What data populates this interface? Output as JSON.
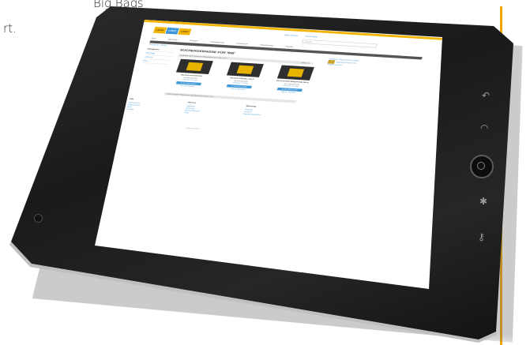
{
  "page_text": {
    "line1": "Big Bags",
    "line2": "rt."
  },
  "colors": {
    "accent": "#f2b400",
    "link": "#3e97d8",
    "tablet": "#1c1c1c"
  },
  "tablet": {
    "icons": [
      "back-icon",
      "wifi-icon",
      "home-button",
      "settings-icon",
      "key-icon"
    ]
  },
  "site": {
    "logos": [
      "LOGO",
      "LOGO",
      "LOGO"
    ],
    "topnav": [
      "Mein Konto",
      "Warenkorb"
    ],
    "search_placeholder": "Suche",
    "nav": [
      "Start",
      "Big Bags",
      "Zubehör",
      "Fasslagerung",
      "Gefahrstoff",
      "Arbeitsschutz",
      "Regale"
    ],
    "breadcrumb": "Startseite › Suche",
    "sidebar": {
      "head": "Kategorien",
      "items": [
        "Big Bags",
        "Zubehör",
        "Filter"
      ]
    },
    "title": "SUCHERGEBNISSE FÜR 'BIB'",
    "sort_label": "Sortieren nach: Relevanz  ▾  Ergebnisse pro Seite: 12  ▾",
    "pager": "Seite 1 von 1",
    "promo": {
      "heading": "Angebot: Wöchentliche Aktion",
      "text": "Big-Bag-Gestell mit Staplertaschen"
    },
    "products": [
      {
        "name": "BIG-BAG-STATION BIB",
        "price": "ab 389,00 EUR",
        "avail": "Lieferzeit: 10 Tage",
        "button": "In den Warenkorb",
        "link": "Auf die Merkliste"
      },
      {
        "name": "BIG-BAG-GESTELL BIB-S",
        "price": "ab 549,00 EUR",
        "avail": "Lieferzeit: 10 Tage",
        "button": "In den Warenkorb",
        "link": "Auf die Merkliste"
      },
      {
        "name": "BIG-BAG-ENTLEERSTATION BIB-E",
        "price": "ab 1.289,00 EUR",
        "avail": "Lieferzeit: 14 Tage",
        "button": "In den Warenkorb",
        "link": "Auf die Merkliste"
      }
    ],
    "footer": {
      "cols": [
        {
          "head": "Info",
          "items": [
            "Impressum",
            "Datenschutz",
            "AGB",
            "Kontakt"
          ]
        },
        {
          "head": "Service",
          "items": [
            "Versand",
            "Zahlung",
            "Widerrufsrecht",
            "FAQ"
          ]
        },
        {
          "head": "Beratung",
          "items": [
            "Anfrage",
            "Rückruf",
            "Katalog bestellen"
          ]
        }
      ],
      "copyright": "© Big Bag Shop"
    }
  }
}
